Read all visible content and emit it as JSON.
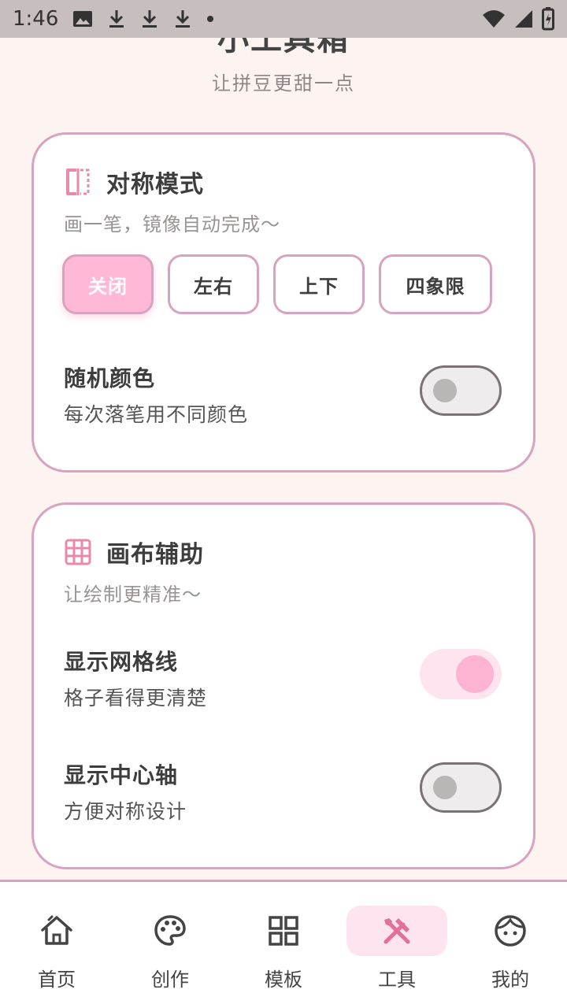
{
  "status_bar": {
    "time": "1:46",
    "icons": [
      "image-icon",
      "download-icon",
      "download-icon",
      "download-icon",
      "dot-icon",
      "wifi-icon",
      "signal-icon",
      "battery-icon"
    ]
  },
  "header": {
    "title": "小工具箱",
    "subtitle": "让拼豆更甜一点"
  },
  "symmetry_card": {
    "icon": "symmetry-icon",
    "title": "对称模式",
    "description": "画一笔，镜像自动完成～",
    "modes": [
      "关闭",
      "左右",
      "上下",
      "四象限"
    ],
    "selected_mode": "关闭",
    "random_color": {
      "title": "随机颜色",
      "subtitle": "每次落笔用不同颜色",
      "enabled": false
    }
  },
  "canvas_card": {
    "icon": "grid-icon",
    "title": "画布辅助",
    "description": "让绘制更精准～",
    "show_grid": {
      "title": "显示网格线",
      "subtitle": "格子看得更清楚",
      "enabled": true
    },
    "show_axis": {
      "title": "显示中心轴",
      "subtitle": "方便对称设计",
      "enabled": false
    }
  },
  "bottom_nav": {
    "items": [
      {
        "label": "首页",
        "icon": "home-icon"
      },
      {
        "label": "创作",
        "icon": "palette-icon"
      },
      {
        "label": "模板",
        "icon": "template-icon"
      },
      {
        "label": "工具",
        "icon": "tools-icon"
      },
      {
        "label": "我的",
        "icon": "face-icon"
      }
    ],
    "active": "工具"
  },
  "colors": {
    "accent_pink": "#ffb8d6",
    "card_border": "#d7a3bf",
    "background": "#fdf3f1"
  }
}
